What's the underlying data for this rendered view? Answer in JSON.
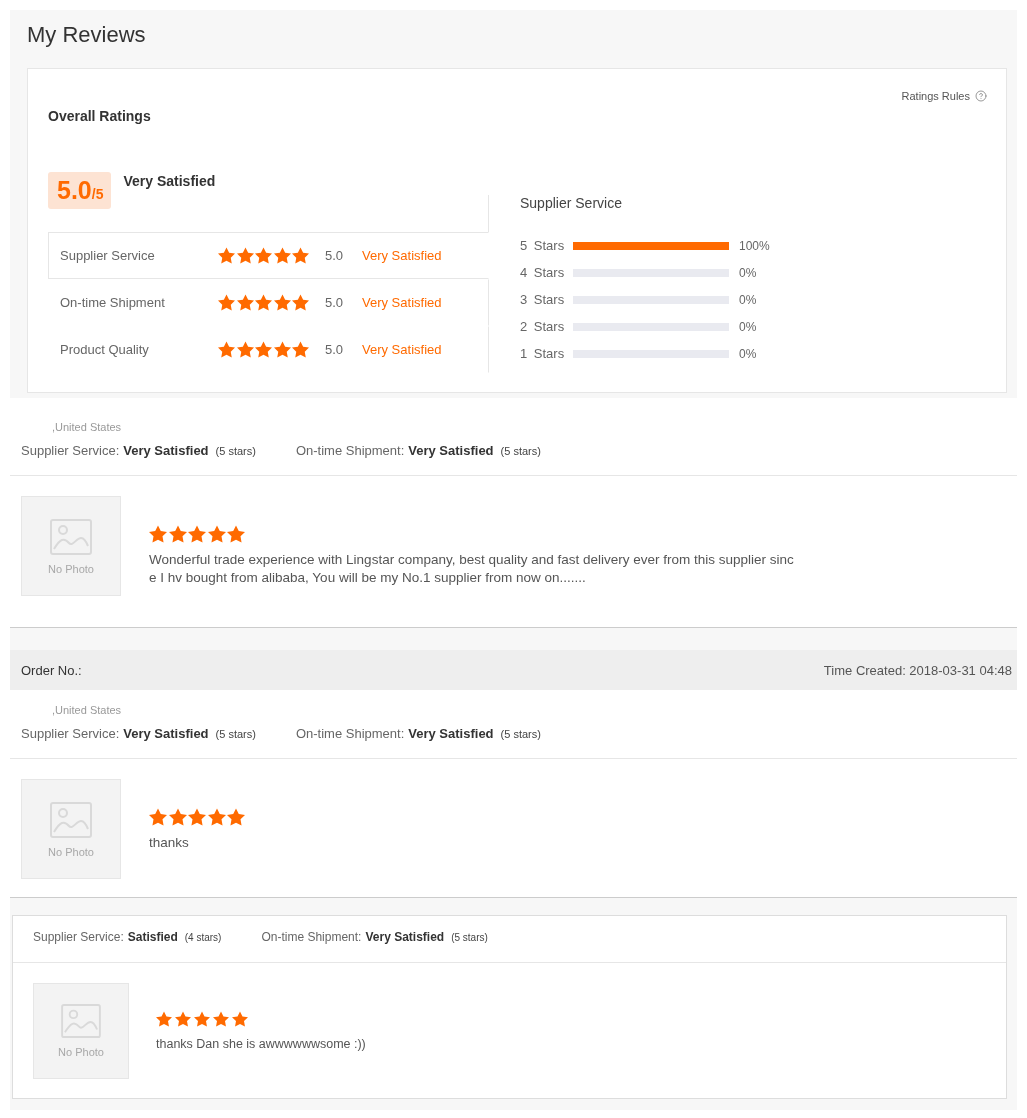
{
  "page": {
    "title": "My Reviews"
  },
  "overall": {
    "heading": "Overall Ratings",
    "rules_link": "Ratings Rules",
    "score": "5.0",
    "score_max": "/5",
    "verdict": "Very Satisfied",
    "categories": [
      {
        "label": "Supplier Service",
        "stars": 5,
        "score": "5.0",
        "verdict": "Very Satisfied",
        "selected": true
      },
      {
        "label": "On-time Shipment",
        "stars": 5,
        "score": "5.0",
        "verdict": "Very Satisfied",
        "selected": false
      },
      {
        "label": "Product Quality",
        "stars": 5,
        "score": "5.0",
        "verdict": "Very Satisfied",
        "selected": false
      }
    ]
  },
  "distribution": {
    "title": "Supplier Service",
    "rows": [
      {
        "label": "5 Stars",
        "level": 1,
        "reading": "100%"
      },
      {
        "label": "4 Stars",
        "level": 0,
        "reading": "0%"
      },
      {
        "label": "3 Stars",
        "level": 0,
        "reading": "0%"
      },
      {
        "label": "2 Stars",
        "level": 0,
        "reading": "0%"
      },
      {
        "label": "1 Stars",
        "level": 0,
        "reading": "0%"
      }
    ]
  },
  "reviews": [
    {
      "kind": "plain",
      "location": ",United States",
      "ratings": [
        {
          "label": "Supplier Service:",
          "verdict": "Very Satisfied",
          "count": "(5 stars)"
        },
        {
          "label": "On-time Shipment:",
          "verdict": "Very Satisfied",
          "count": "(5 stars)"
        }
      ],
      "photo_label": "No Photo",
      "stars": 5,
      "comment": "Wonderful trade experience with Lingstar company, best quality and fast delivery ever from this supplier since I hv bought from alibaba, You will be my No.1 supplier from now on......."
    },
    {
      "kind": "plain",
      "order": {
        "label": "Order No.:",
        "time": "Time Created: 2018-03-31 04:48"
      },
      "location": ",United States",
      "ratings": [
        {
          "label": "Supplier Service:",
          "verdict": "Very Satisfied",
          "count": "(5 stars)"
        },
        {
          "label": "On-time Shipment:",
          "verdict": "Very Satisfied",
          "count": "(5 stars)"
        }
      ],
      "photo_label": "No Photo",
      "stars": 5,
      "comment": "thanks"
    },
    {
      "kind": "boxed",
      "ratings": [
        {
          "label": "Supplier Service:",
          "verdict": "Satisfied",
          "count": "(4 stars)"
        },
        {
          "label": "On-time Shipment:",
          "verdict": "Very Satisfied",
          "count": "(5 stars)"
        }
      ],
      "photo_label": "No Photo",
      "stars": 5,
      "comment": "thanks Dan she is awwwwwwsome :))"
    }
  ]
}
